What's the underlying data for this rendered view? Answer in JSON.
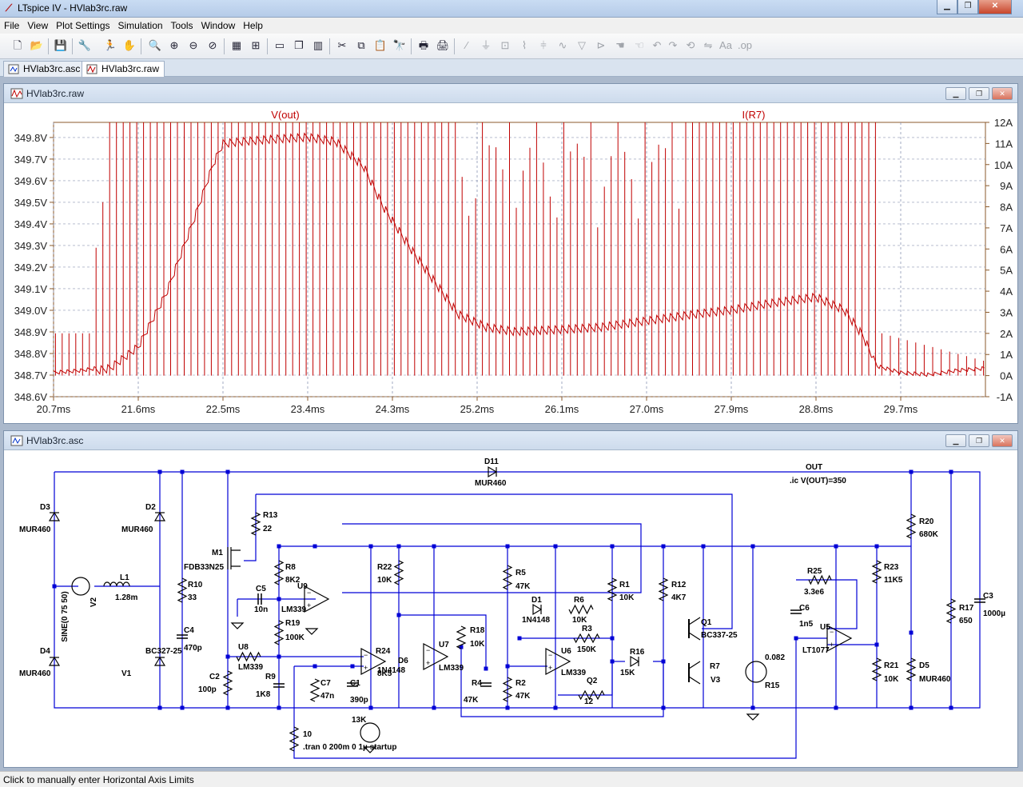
{
  "window": {
    "title": "LTspice IV - HVlab3rc.raw",
    "app_icon": "ltspice-logo-icon"
  },
  "menu": [
    "File",
    "View",
    "Plot Settings",
    "Simulation",
    "Tools",
    "Window",
    "Help"
  ],
  "tabs": [
    {
      "label": "HVlab3rc.asc",
      "icon": "schematic-icon"
    },
    {
      "label": "HVlab3rc.raw",
      "icon": "waveform-icon",
      "active": true
    }
  ],
  "plot_window": {
    "title": "HVlab3rc.raw"
  },
  "schematic_window": {
    "title": "HVlab3rc.asc"
  },
  "statusbar": {
    "text": "Click to manually enter Horizontal Axis Limits"
  },
  "colors": {
    "trace": "#c00000",
    "axis": "#8b5a2b",
    "wire": "#0000d6",
    "junction": "#0000d6",
    "component": "#000000"
  },
  "chart_data": {
    "type": "line",
    "series": [
      {
        "name": "V(out)"
      },
      {
        "name": "I(R7)"
      }
    ],
    "x_unit": "ms",
    "x_ticks": [
      "20.7ms",
      "21.6ms",
      "22.5ms",
      "23.4ms",
      "24.3ms",
      "25.2ms",
      "26.1ms",
      "27.0ms",
      "27.9ms",
      "28.8ms",
      "29.7ms"
    ],
    "x_tick_values": [
      20.7,
      21.6,
      22.5,
      23.4,
      24.3,
      25.2,
      26.1,
      27.0,
      27.9,
      28.8,
      29.7
    ],
    "xlim": [
      20.7,
      30.6
    ],
    "y_left_ticks": [
      "349.8V",
      "349.7V",
      "349.6V",
      "349.5V",
      "349.4V",
      "349.3V",
      "349.2V",
      "349.1V",
      "349.0V",
      "348.9V",
      "348.8V",
      "348.7V",
      "348.6V"
    ],
    "ylim_left": [
      348.6,
      349.87
    ],
    "y_right_ticks": [
      "12A",
      "11A",
      "10A",
      "9A",
      "8A",
      "7A",
      "6A",
      "5A",
      "4A",
      "3A",
      "2A",
      "1A",
      "0A",
      "-1A"
    ],
    "ylim_right": [
      -1,
      12
    ],
    "grid": true,
    "vout_envelope": {
      "x": [
        20.7,
        21.0,
        21.3,
        21.6,
        21.9,
        22.2,
        22.4,
        22.5,
        22.7,
        23.0,
        23.4,
        23.7,
        24.0,
        24.2,
        24.5,
        24.8,
        25.0,
        25.3,
        25.6,
        26.1,
        26.5,
        27.0,
        27.5,
        27.9,
        28.3,
        28.8,
        29.1,
        29.3,
        29.45,
        29.7,
        30.0,
        30.3,
        30.6
      ],
      "y": [
        348.72,
        348.73,
        348.75,
        348.85,
        349.1,
        349.45,
        349.7,
        349.79,
        349.8,
        349.81,
        349.82,
        349.8,
        349.68,
        349.5,
        349.3,
        349.12,
        349.0,
        348.94,
        348.92,
        348.93,
        348.94,
        348.97,
        349.0,
        349.02,
        349.05,
        349.08,
        349.02,
        348.9,
        348.75,
        348.72,
        348.71,
        348.73,
        348.74
      ]
    }
  },
  "schematic": {
    "labels": [
      "D11",
      "MUR460",
      "OUT",
      ".ic V(OUT)=350",
      "D3",
      "MUR460",
      "D2",
      "MUR460",
      "R13",
      "22",
      "R20",
      "680K",
      "M1",
      "FDB33N25",
      "R8",
      "8K2",
      "R5",
      "47K",
      "R22",
      "10K",
      "R23",
      "11K5",
      "R25",
      "3.3e6",
      "C3",
      "1000µ",
      "R10",
      "33",
      "L1",
      "1.28m",
      "V2",
      "SINE(0 75 50)",
      "C5",
      "10n",
      "U9",
      "LM339",
      "R12",
      "4K7",
      "R1",
      "10K",
      "D1",
      "1N4148",
      "R6",
      "10K",
      "C6",
      "1n5",
      "R17",
      "650",
      "Q1",
      "BC337-25",
      "R3",
      "150K",
      "U5",
      "LT1077",
      "C4",
      "470p",
      "R19",
      "100K",
      "R18",
      "10K",
      "U7",
      "LM339",
      "U6",
      "LM339",
      "D6",
      "1N4148",
      "R16",
      "15K",
      "U8",
      "LM339",
      "R24",
      "8K5",
      "R21",
      "10K",
      "D5",
      "MUR460",
      "D4",
      "MUR460",
      "BC327-25",
      "V1",
      "R7",
      "0.082",
      "C2",
      "100p",
      "R9",
      "1K8",
      "C7",
      "47n",
      "C1",
      "390p",
      "R4",
      "47K",
      "R2",
      "47K",
      "Q2",
      "12",
      "V3",
      "R15",
      "13K",
      "10",
      ".tran 0 200m 0 1µ startup"
    ]
  }
}
